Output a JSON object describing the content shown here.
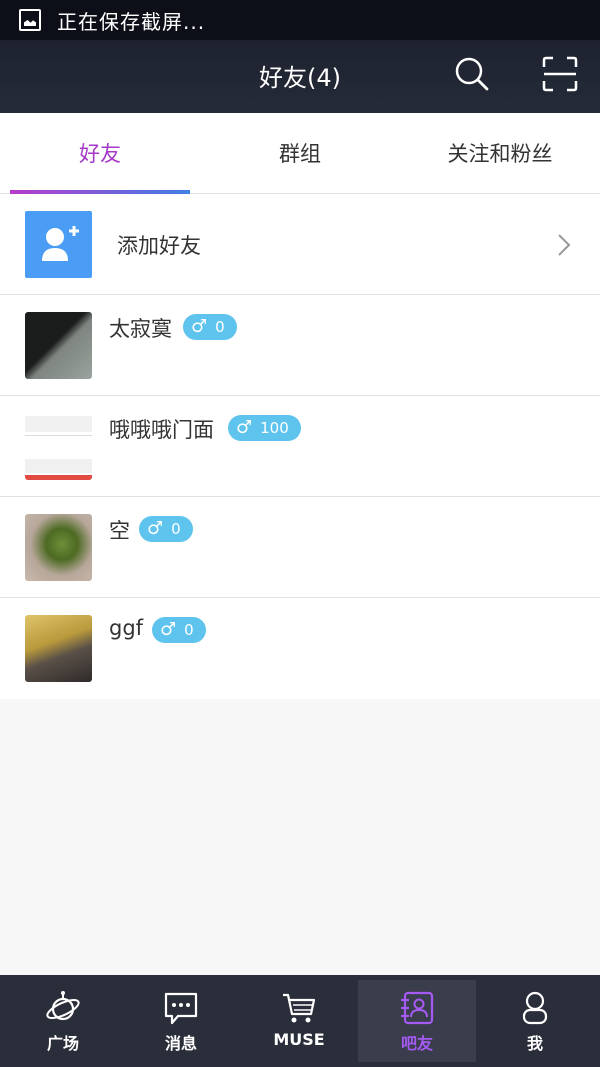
{
  "status_bar": {
    "text": "正在保存截屏...",
    "icon": "screenshot-icon"
  },
  "header": {
    "title": "好友(4)",
    "search_icon": "search-icon",
    "scan_icon": "scan-icon"
  },
  "tabs": [
    {
      "label": "好友",
      "active": true
    },
    {
      "label": "群组",
      "active": false
    },
    {
      "label": "关注和粉丝",
      "active": false
    }
  ],
  "add_friend": {
    "label": "添加好友",
    "icon": "add-user-icon"
  },
  "friends": [
    {
      "name": "太寂寞",
      "gender": "♂",
      "level": "0"
    },
    {
      "name": "哦哦哦门面",
      "gender": "♂",
      "level": "100"
    },
    {
      "name": "空",
      "gender": "♂",
      "level": "0"
    },
    {
      "name": "ggf",
      "gender": "♂",
      "level": "0"
    }
  ],
  "tab_bar": [
    {
      "label": "广场",
      "icon": "planet-icon",
      "active": false
    },
    {
      "label": "消息",
      "icon": "message-icon",
      "active": false
    },
    {
      "label": "MUSE",
      "icon": "cart-icon",
      "active": false
    },
    {
      "label": "吧友",
      "icon": "contacts-icon",
      "active": true
    },
    {
      "label": "我",
      "icon": "person-icon",
      "active": false
    }
  ],
  "colors": {
    "accent": "#a639c8",
    "badge": "#5ec4ee",
    "header": "#1e2230",
    "tabbar": "#2a2d3a",
    "add_icon_bg": "#4a9cf5"
  }
}
